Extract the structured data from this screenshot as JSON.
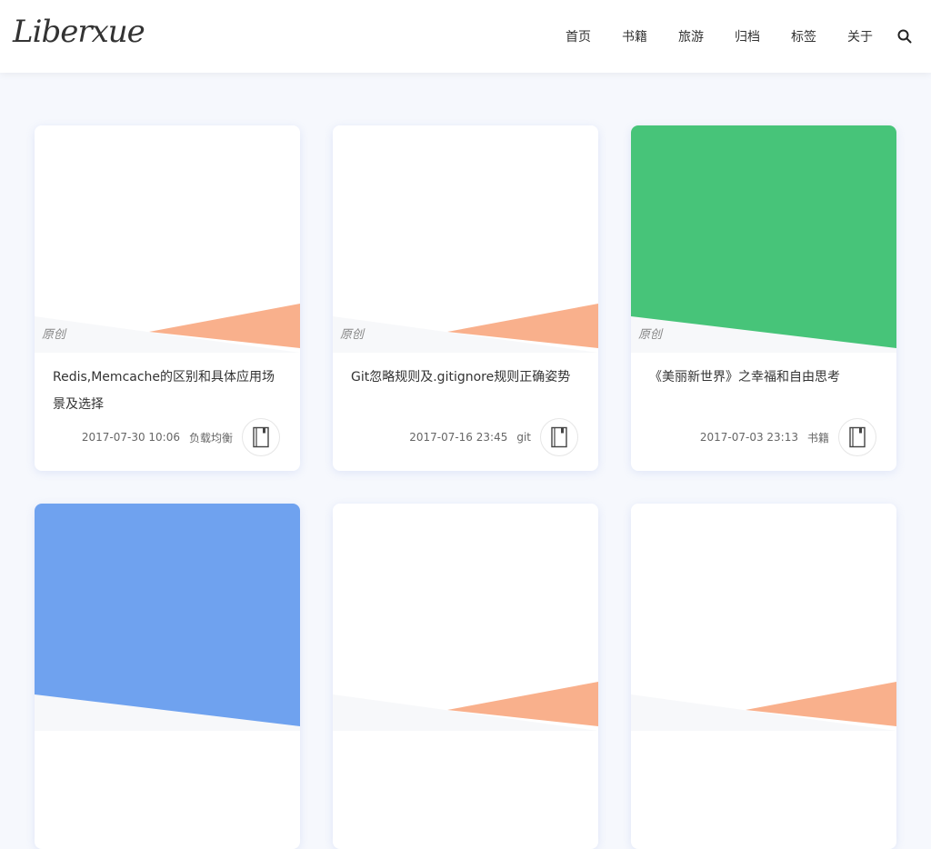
{
  "header": {
    "logo_text": "Liberxue",
    "nav": [
      "首页",
      "书籍",
      "旅游",
      "归档",
      "标签",
      "关于"
    ]
  },
  "colors": {
    "salmon": "#f9b08c",
    "green": "#47c479",
    "blue": "#6fa2ef",
    "white": "#ffffff"
  },
  "cards": [
    {
      "origin": "原创",
      "title": "Redis,Memcache的区别和具体应用场景及选择",
      "date": "2017-07-30 10:06",
      "tag": "负载均衡",
      "cover": "white"
    },
    {
      "origin": "原创",
      "title": "Git忽略规则及.gitignore规则正确姿势",
      "date": "2017-07-16 23:45",
      "tag": "git",
      "cover": "white"
    },
    {
      "origin": "原创",
      "title": "《美丽新世界》之幸福和自由思考",
      "date": "2017-07-03 23:13",
      "tag": "书籍",
      "cover": "green"
    },
    {
      "cover": "blue"
    },
    {
      "cover": "white"
    },
    {
      "cover": "white"
    }
  ]
}
